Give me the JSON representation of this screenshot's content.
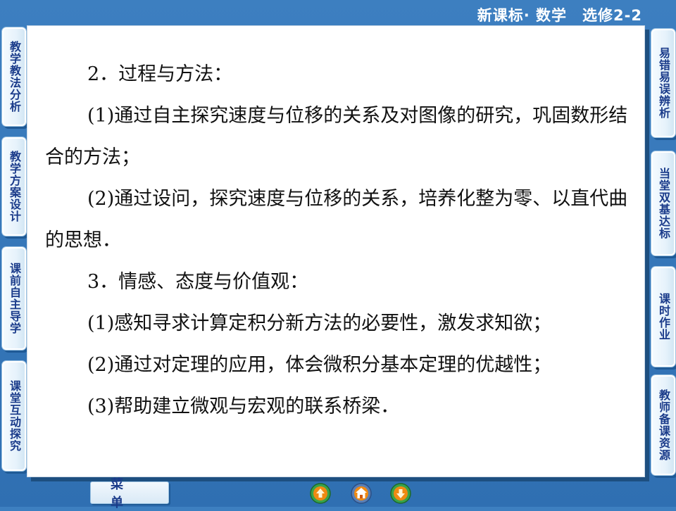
{
  "header": {
    "title": "新课标· 数学　选修2-2"
  },
  "left_nav": [
    {
      "label": "教学教法分析"
    },
    {
      "label": "教学方案设计"
    },
    {
      "label": "课前自主导学"
    },
    {
      "label": "课堂互动探究"
    }
  ],
  "right_nav": [
    {
      "label": "易错易误辨析"
    },
    {
      "label": "当堂双基达标"
    },
    {
      "label": "课时作业"
    },
    {
      "label": "教师备课资源"
    }
  ],
  "content": {
    "line1": "2．过程与方法：",
    "line2": "(1)通过自主探究速度与位移的关系及对图像的研究，巩固数形结合的方法；",
    "line3": "(2)通过设问，探究速度与位移的关系，培养化整为零、以直代曲的思想．",
    "line4": "3．情感、态度与价值观：",
    "line5": "(1)感知寻求计算定积分新方法的必要性，激发求知欲；",
    "line6": "(2)通过对定理的应用，体会微积分基本定理的优越性；",
    "line7": "(3)帮助建立微观与宏观的联系桥梁．"
  },
  "footer": {
    "menu_label": "菜单",
    "prev_icon": "arrow-up-icon",
    "home_icon": "home-icon",
    "next_icon": "arrow-down-icon"
  },
  "colors": {
    "background": "#2f6fb2",
    "tab_text": "#1a3b8a",
    "nav_orange": "#f08a12",
    "nav_green": "#3aa34a"
  }
}
